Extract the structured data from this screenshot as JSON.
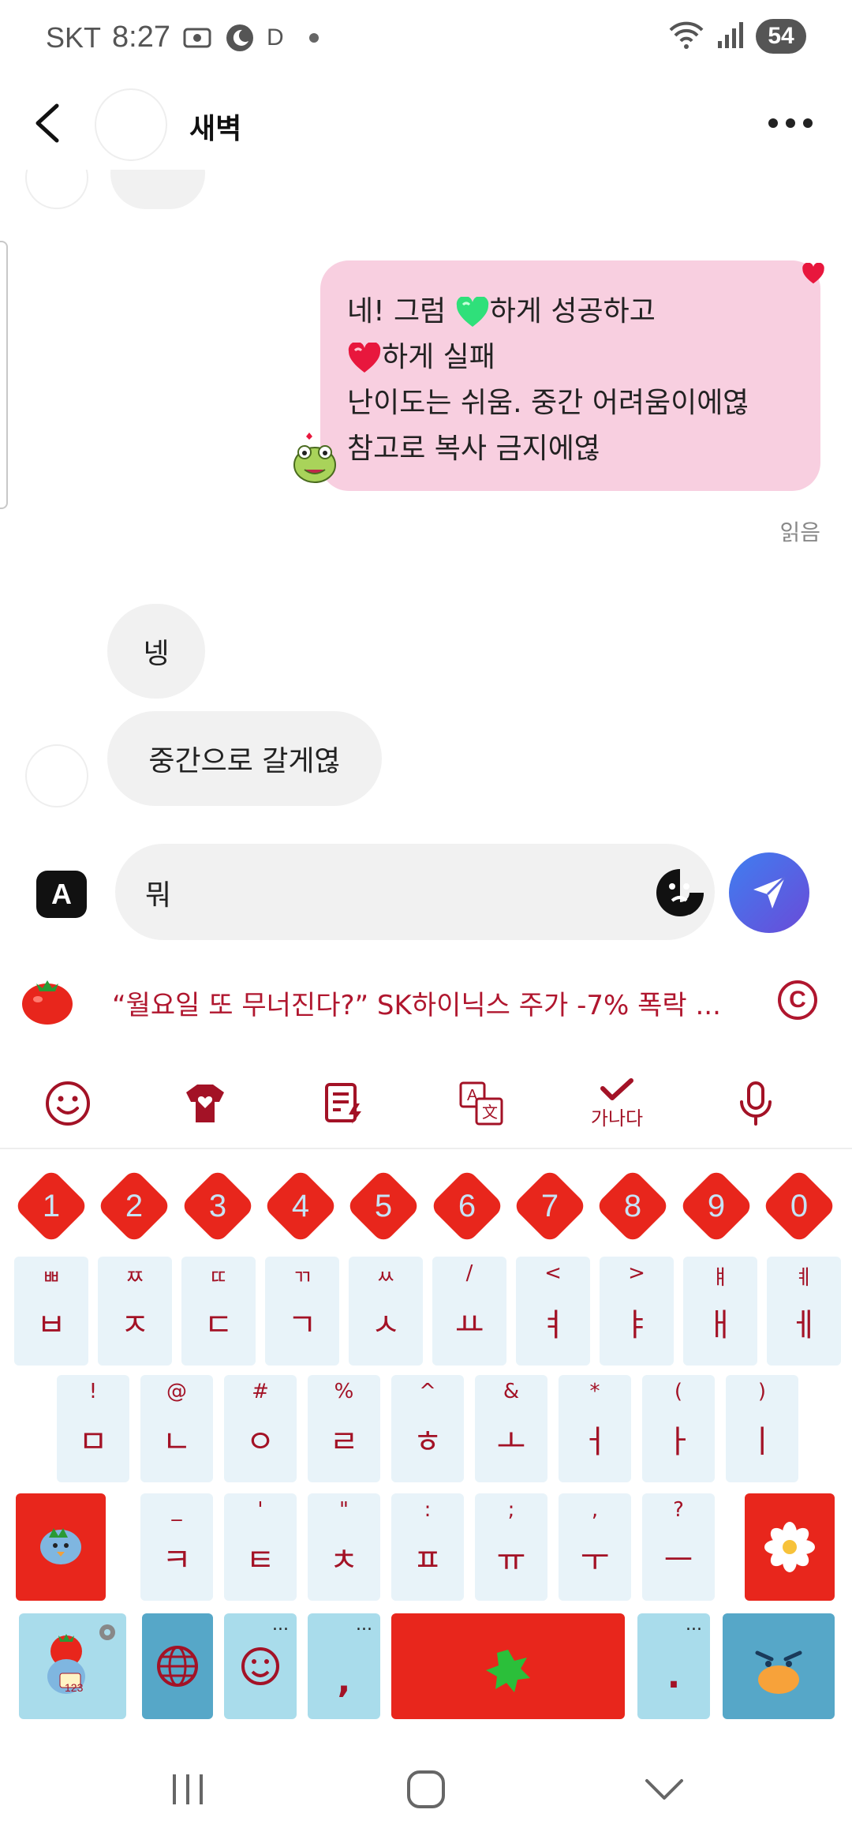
{
  "status_bar": {
    "carrier": "SKT",
    "time": "8:27",
    "extra": "D",
    "battery": "54"
  },
  "header": {
    "title": "새벽"
  },
  "messages": {
    "outgoing": {
      "line1_a": "네! 그럼 ",
      "line1_b": "하게 성공하고",
      "line2_b": "하게 실패",
      "line3": "난이도는 쉬움. 중간 어려움이에엲",
      "line4": "참고로 복사 금지에엲",
      "read_label": "읽음"
    },
    "incoming": [
      {
        "text": "넹"
      },
      {
        "text": "중간으로 갈게엲"
      }
    ]
  },
  "composer": {
    "mode_label": "A",
    "input_value": "뭐"
  },
  "news": {
    "headline": "“월요일 또 무너진다?” SK하이닉스 주가 -7% 폭락 ...",
    "copy_label": "C"
  },
  "toolbar": {
    "spell_label": "가나다"
  },
  "keyboard": {
    "numbers": [
      "1",
      "2",
      "3",
      "4",
      "5",
      "6",
      "7",
      "8",
      "9",
      "0"
    ],
    "row1": [
      {
        "main": "ㅂ",
        "sub": "ㅃ"
      },
      {
        "main": "ㅈ",
        "sub": "ㅉ"
      },
      {
        "main": "ㄷ",
        "sub": "ㄸ"
      },
      {
        "main": "ㄱ",
        "sub": "ㄲ"
      },
      {
        "main": "ㅅ",
        "sub": "ㅆ"
      },
      {
        "main": "ㅛ",
        "sub": "/"
      },
      {
        "main": "ㅕ",
        "sub": "<"
      },
      {
        "main": "ㅑ",
        "sub": ">"
      },
      {
        "main": "ㅐ",
        "sub": "ㅒ"
      },
      {
        "main": "ㅔ",
        "sub": "ㅖ"
      }
    ],
    "row2": [
      {
        "main": "ㅁ",
        "sub": "!"
      },
      {
        "main": "ㄴ",
        "sub": "@"
      },
      {
        "main": "ㅇ",
        "sub": "#"
      },
      {
        "main": "ㄹ",
        "sub": "%"
      },
      {
        "main": "ㅎ",
        "sub": "^"
      },
      {
        "main": "ㅗ",
        "sub": "&"
      },
      {
        "main": "ㅓ",
        "sub": "*"
      },
      {
        "main": "ㅏ",
        "sub": "("
      },
      {
        "main": "ㅣ",
        "sub": ")"
      }
    ],
    "row3": [
      {
        "main": "ㅋ",
        "sub": "_"
      },
      {
        "main": "ㅌ",
        "sub": "'"
      },
      {
        "main": "ㅊ",
        "sub": "\""
      },
      {
        "main": "ㅍ",
        "sub": ":"
      },
      {
        "main": "ㅠ",
        "sub": ";"
      },
      {
        "main": "ㅜ",
        "sub": ","
      },
      {
        "main": "ㅡ",
        "sub": "?"
      }
    ],
    "comma": ",",
    "period": ".",
    "dots": "...",
    "badge": "123"
  },
  "colors": {
    "bubble_out": "#f8cfe0",
    "bubble_in": "#f1f1f1",
    "accent_red": "#e8261c",
    "key_text": "#a31226",
    "send_gradient_start": "#3f7ef0",
    "send_gradient_end": "#6a4bd8"
  }
}
